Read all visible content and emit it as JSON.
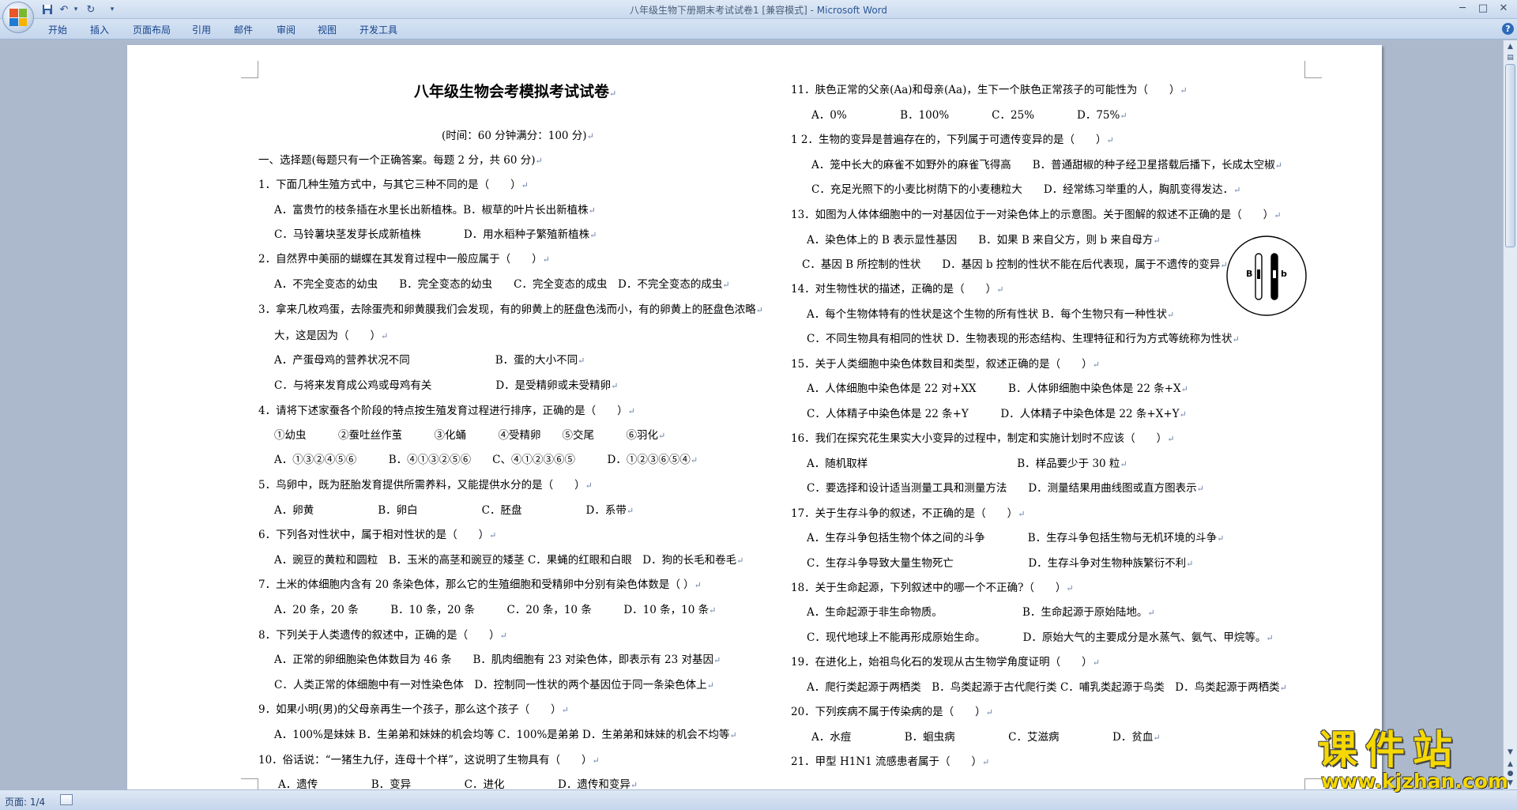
{
  "window": {
    "title": "八年级生物下册期末考试试卷1 [兼容模式] - ",
    "app_name": "Microsoft Word",
    "minimize": "─",
    "maximize": "□",
    "close": "✕"
  },
  "quick_access": {
    "save_icon": "floppy-icon",
    "undo": "↶",
    "redo": "↻",
    "customize": "▾"
  },
  "ribbon_tabs": [
    "开始",
    "插入",
    "页面布局",
    "引用",
    "邮件",
    "审阅",
    "视图",
    "开发工具"
  ],
  "help": "?",
  "doc": {
    "title": "八年级生物会考模拟考试试卷",
    "left_lines": [
      "(时间：60 分钟满分：100 分)",
      "一、选择题(每题只有一个正确答案。每题 2 分，共 60 分)",
      "1．下面几种生殖方式中，与其它三种不同的是（　　）",
      "A．富贵竹的枝条插在水里长出新植株。B．椒草的叶片长出新植株",
      "C．马铃薯块茎发芽长成新植株　　　　D．用水稻种子繁殖新植株",
      "2．自然界中美丽的蝴蝶在其发育过程中一般应属于（　　）",
      "A．不完全变态的幼虫　　B．完全变态的幼虫　　C．完全变态的成虫　D．不完全变态的成虫",
      "3．拿来几枚鸡蛋，去除蛋壳和卵黄膜我们会发现，有的卵黄上的胚盘色浅而小，有的卵黄上的胚盘色浓略",
      "大，这是因为（　　）",
      "A．产蛋母鸡的营养状况不同　　　　　　　　B．蛋的大小不同",
      "C．与将来发育成公鸡或母鸡有关　　　　　　D．是受精卵或未受精卵",
      "4．请将下述家蚕各个阶段的特点按生殖发育过程进行排序，正确的是（　　）",
      "①幼虫　　　②蚕吐丝作茧　　　③化蛹　　　④受精卵　　⑤交尾　　　⑥羽化",
      "A．①③②④⑤⑥　　　B．④①③②⑤⑥　　C、④①②③⑥⑤　　　D．①②③⑥⑤④",
      "5．鸟卵中，既为胚胎发育提供所需养料，又能提供水分的是（　　）",
      "A．卵黄　　　　　　B．卵白　　　　　　C．胚盘　　　　　　D．系带",
      "6．下列各对性状中，属于相对性状的是（　　）",
      "A．豌豆的黄粒和圆粒　B．玉米的高茎和豌豆的矮茎 C．果蝇的红眼和白眼　D．狗的长毛和卷毛",
      "7．土米的体细胞内含有 20 条染色体，那么它的生殖细胞和受精卵中分别有染色体数是（ ）",
      "A．20 条，20 条　　　B．10 条，20 条　　　C．20 条，10 条　　　D．10 条，10 条",
      "8．下列关于人类遗传的叙述中，正确的是（　　）",
      "A．正常的卵细胞染色体数目为 46 条　　B．肌肉细胞有 23 对染色体，即表示有 23 对基因",
      "C．人类正常的体细胞中有一对性染色体　D．控制同一性状的两个基因位于同一条染色体上",
      "9．如果小明(男)的父母亲再生一个孩子，那么这个孩子（　　）",
      "A．100%是妹妹 B．生弟弟和妹妹的机会均等 C．100%是弟弟 D．生弟弟和妹妹的机会不均等",
      "10．俗话说：“一猪生九仔，连母十个样”，这说明了生物具有（　　）",
      "A．遗传　　　　　B．变异　　　　　C．进化　　　　　D．遗传和变异"
    ],
    "right_lines": [
      "11．肤色正常的父亲(Aa)和母亲(Aa)，生下一个肤色正常孩子的可能性为（　　）",
      "A．0%　　　　　B．100%　　　　C．25%　　　　D．75%",
      "1 2．生物的变异是普遍存在的，下列属于可遗传变异的是（　　）",
      "A．笼中长大的麻雀不如野外的麻雀飞得高　　B．普通甜椒的种子经卫星搭载后播下，长成太空椒",
      "C．充足光照下的小麦比树荫下的小麦穗粒大　　D．经常练习举重的人，胸肌变得发达．",
      "13．如图为人体体细胞中的一对基因位于一对染色体上的示意图。关于图解的叙述不正确的是（　　）",
      "A．染色体上的 B 表示显性基因　　B．如果 B 来自父方，则 b 来自母方",
      "C．基因 B 所控制的性状　　D．基因 b 控制的性状不能在后代表现，属于不遗传的变异",
      "14．对生物性状的描述，正确的是（　　）",
      "A．每个生物体特有的性状是这个生物的所有性状 B．每个生物只有一种性状",
      "C．不同生物具有相同的性状 D．生物表现的形态结构、生理特征和行为方式等统称为性状",
      "15．关于人类细胞中染色体数目和类型，叙述正确的是（　　）",
      "A．人体细胞中染色体是 22 对+XX　　　B．人体卵细胞中染色体是 22 条+X",
      "C．人体精子中染色体是 22 条+Y　　　D．人体精子中染色体是 22 条+X+Y",
      "16．我们在探究花生果实大小变异的过程中，制定和实施计划时不应该（　　）",
      "A．随机取样　　　　　　　　　　　　　　B．样品要少于 30 粒",
      "C．要选择和设计适当测量工具和测量方法　　D．测量结果用曲线图或直方图表示",
      "17．关于生存斗争的叙述，不正确的是（　　）",
      "A．生存斗争包括生物个体之间的斗争　　　　B．生存斗争包括生物与无机环境的斗争",
      "C．生存斗争导致大量生物死亡　　　　　　　D．生存斗争对生物种族繁衍不利",
      "18．关于生命起源，下列叙述中的哪一个不正确?（　　）",
      "A．生命起源于非生命物质。　　　　　　　　B．生命起源于原始陆地。",
      "C．现代地球上不能再形成原始生命。　　　　D．原始大气的主要成分是水蒸气、氨气、甲烷等。",
      "19．在进化上，始祖鸟化石的发现从古生物学角度证明（　　）",
      "A．爬行类起源于两栖类　B．鸟类起源于古代爬行类 C．哺乳类起源于鸟类　D．鸟类起源于两栖类",
      "20．下列疾病不属于传染病的是（　　）",
      "A．水痘　　　　　B．蛔虫病　　　　　C．艾滋病　　　　　D．贫血",
      "21．甲型 H1N1 流感患者属于（　　）"
    ],
    "figure_labels": {
      "left": "B",
      "right": "b"
    },
    "paragraph_mark": "↵"
  },
  "status": {
    "page": "页面: 1/4"
  },
  "watermark": {
    "name": "课件站",
    "url": "www.kjzhan.com"
  }
}
